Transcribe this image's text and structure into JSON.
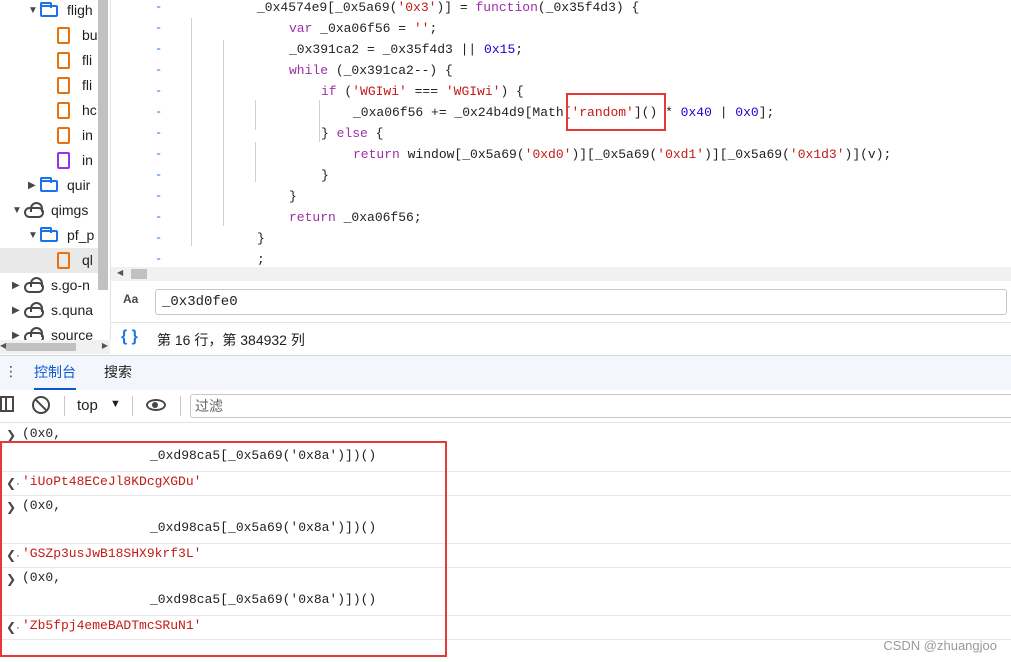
{
  "file_tree": {
    "items": [
      {
        "label": "fligh",
        "type": "folder",
        "expanded": true
      },
      {
        "label": "bu",
        "type": "file"
      },
      {
        "label": "fli",
        "type": "file"
      },
      {
        "label": "fli",
        "type": "file"
      },
      {
        "label": "hc",
        "type": "file"
      },
      {
        "label": "in",
        "type": "file"
      },
      {
        "label": "in",
        "type": "file"
      },
      {
        "label": "quir",
        "type": "folder",
        "expanded": false
      },
      {
        "label": "qimgs",
        "type": "domain",
        "expanded": true
      },
      {
        "label": "pf_p",
        "type": "folder",
        "expanded": true
      },
      {
        "label": "ql",
        "type": "file",
        "selected": true
      },
      {
        "label": "s.go-n",
        "type": "domain",
        "expanded": false
      },
      {
        "label": "s.quna",
        "type": "domain",
        "expanded": false
      },
      {
        "label": "source",
        "type": "domain",
        "expanded": false
      }
    ]
  },
  "code": {
    "lines": [
      {
        "indent": 0,
        "tokens": [
          [
            "id",
            "_0x4574e9[_0x5a69("
          ],
          [
            "str",
            "'0x3'"
          ],
          [
            "id",
            ")] = "
          ],
          [
            "kw",
            "function"
          ],
          [
            "id",
            "(_0x35f4d3) {"
          ]
        ]
      },
      {
        "indent": 1,
        "tokens": [
          [
            "kw",
            "var "
          ],
          [
            "id",
            "_0xa06f56 = "
          ],
          [
            "str",
            "''"
          ],
          [
            "id",
            ";"
          ]
        ]
      },
      {
        "indent": 1,
        "tokens": [
          [
            "id",
            "_0x391ca2 = _0x35f4d3 || "
          ],
          [
            "num",
            "0x15"
          ],
          [
            "id",
            ";"
          ]
        ]
      },
      {
        "indent": 1,
        "tokens": [
          [
            "kw",
            "while "
          ],
          [
            "id",
            "(_0x391ca2--) {"
          ]
        ]
      },
      {
        "indent": 2,
        "tokens": [
          [
            "kw",
            "if "
          ],
          [
            "id",
            "("
          ],
          [
            "str",
            "'WGIwi'"
          ],
          [
            "id",
            " === "
          ],
          [
            "str",
            "'WGIwi'"
          ],
          [
            "id",
            ") {"
          ]
        ]
      },
      {
        "indent": 3,
        "tokens": [
          [
            "id",
            "_0xa06f56 += _0x24b4d9[Math["
          ],
          [
            "str",
            "'random'"
          ],
          [
            "id",
            "]() * "
          ],
          [
            "num",
            "0x40"
          ],
          [
            "id",
            " | "
          ],
          [
            "num",
            "0x0"
          ],
          [
            "id",
            "];"
          ]
        ]
      },
      {
        "indent": 2,
        "tokens": [
          [
            "id",
            "} "
          ],
          [
            "kw",
            "else "
          ],
          [
            "id",
            "{"
          ]
        ]
      },
      {
        "indent": 3,
        "tokens": [
          [
            "kw",
            "return "
          ],
          [
            "id",
            "window[_0x5a69("
          ],
          [
            "str",
            "'0xd0'"
          ],
          [
            "id",
            ")][_0x5a69("
          ],
          [
            "str",
            "'0xd1'"
          ],
          [
            "id",
            ")][_0x5a69("
          ],
          [
            "str",
            "'0x1d3'"
          ],
          [
            "id",
            ")](v);"
          ]
        ]
      },
      {
        "indent": 2,
        "tokens": [
          [
            "id",
            "}"
          ]
        ]
      },
      {
        "indent": 1,
        "tokens": [
          [
            "id",
            "}"
          ]
        ]
      },
      {
        "indent": 1,
        "tokens": [
          [
            "kw",
            "return "
          ],
          [
            "id",
            "_0xa06f56;"
          ]
        ]
      },
      {
        "indent": 0,
        "tokens": [
          [
            "id",
            "}"
          ]
        ]
      },
      {
        "indent": 0,
        "tokens": [
          [
            "id",
            ";"
          ]
        ]
      }
    ],
    "gutter_mark": "-"
  },
  "search": {
    "case_icon": "Aa",
    "query": "_0x3d0fe0"
  },
  "status": {
    "braces": "{ }",
    "position": "第 16 行，第 384932 列"
  },
  "drawer": {
    "tabs": [
      {
        "label": "控制台",
        "active": true
      },
      {
        "label": "搜索",
        "active": false
      }
    ],
    "menu": "⋮"
  },
  "console_toolbar": {
    "context": "top",
    "filter_placeholder": "过滤"
  },
  "console": {
    "entries": [
      {
        "kind": "input",
        "line1": "(0x0,",
        "line2": "_0xd98ca5[_0x5a69('0x8a')])()"
      },
      {
        "kind": "result",
        "value": "'iUoPt48ECeJl8KDcgXGDu'"
      },
      {
        "kind": "input",
        "line1": "(0x0,",
        "line2": "_0xd98ca5[_0x5a69('0x8a')])()"
      },
      {
        "kind": "result",
        "value": "'GSZp3usJwB18SHX9krf3L'"
      },
      {
        "kind": "input",
        "line1": "(0x0,",
        "line2": "_0xd98ca5[_0x5a69('0x8a')])()"
      },
      {
        "kind": "result",
        "value": "'Zb5fpj4emeBADTmcSRuN1'"
      }
    ]
  },
  "watermark": "CSDN @zhuangjoo",
  "colors": {
    "accent": "#0b57d0",
    "highlight_box": "#e53935",
    "string": "#c41a16",
    "keyword": "#9d2fa8",
    "number": "#1c00cf"
  }
}
